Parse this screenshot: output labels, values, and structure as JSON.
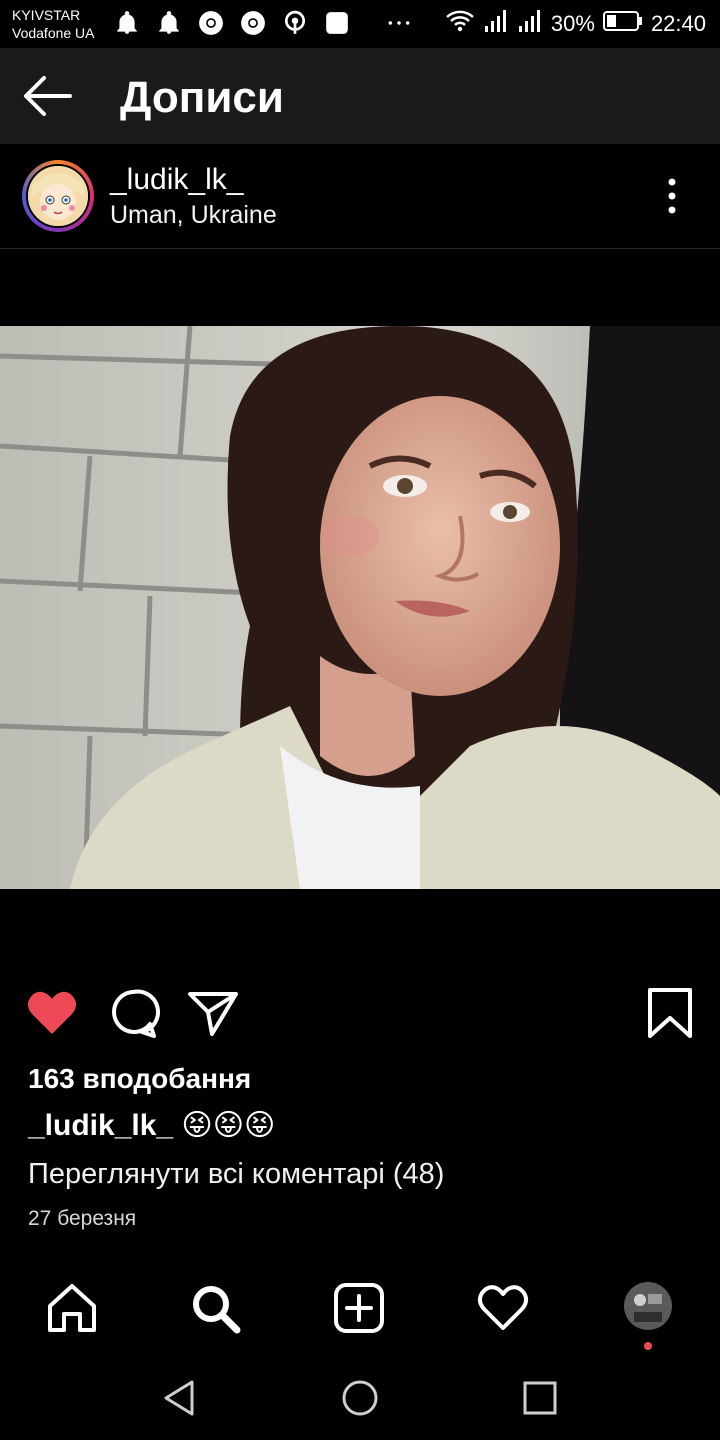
{
  "status_bar": {
    "carrier_1": "KYIVSTAR",
    "carrier_2": "Vodafone UA",
    "battery": "30%",
    "time": "22:40"
  },
  "app_bar": {
    "title": "Дописи"
  },
  "post": {
    "username": "_ludik_lk_",
    "location": "Uman, Ukraine",
    "likes": "163 вподобання",
    "caption_user": "_ludik_lk_",
    "caption_text": "😝😝😝",
    "view_comments": "Переглянути всі коментарі (48)",
    "date": "27 березня"
  },
  "colors": {
    "like_red": "#ed4956",
    "app_bar_bg": "#1a1a1a",
    "notification_dot": "#ed4956"
  }
}
